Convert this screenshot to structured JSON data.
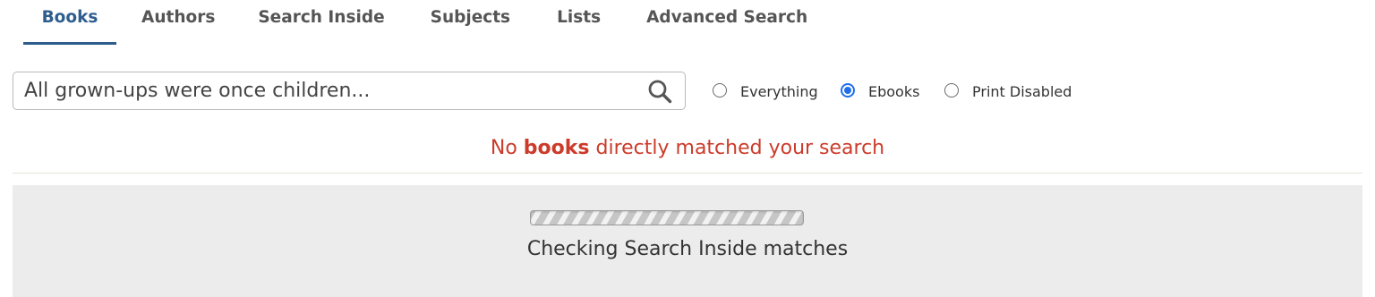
{
  "tabs": [
    {
      "label": "Books",
      "active": true
    },
    {
      "label": "Authors",
      "active": false
    },
    {
      "label": "Search Inside",
      "active": false
    },
    {
      "label": "Subjects",
      "active": false
    },
    {
      "label": "Lists",
      "active": false
    },
    {
      "label": "Advanced Search",
      "active": false
    }
  ],
  "search": {
    "placeholder": "All grown-ups were once children...",
    "value": "",
    "button_icon": "search-icon"
  },
  "filters": {
    "options": [
      {
        "label": "Everything",
        "checked": false
      },
      {
        "label": "Ebooks",
        "checked": true
      },
      {
        "label": "Print Disabled",
        "checked": false
      }
    ],
    "selected": "Ebooks"
  },
  "results": {
    "message_prefix": "No ",
    "message_emphasis": "books",
    "message_suffix": " directly matched your search"
  },
  "search_inside": {
    "status": "Checking Search Inside matches",
    "progress_indicator": "indeterminate-striped-bar"
  },
  "colors": {
    "active_tab": "#2e5d8e",
    "error_text": "#cc3b2a",
    "radio_selected": "#1f6feb",
    "panel_background": "#ececec"
  }
}
